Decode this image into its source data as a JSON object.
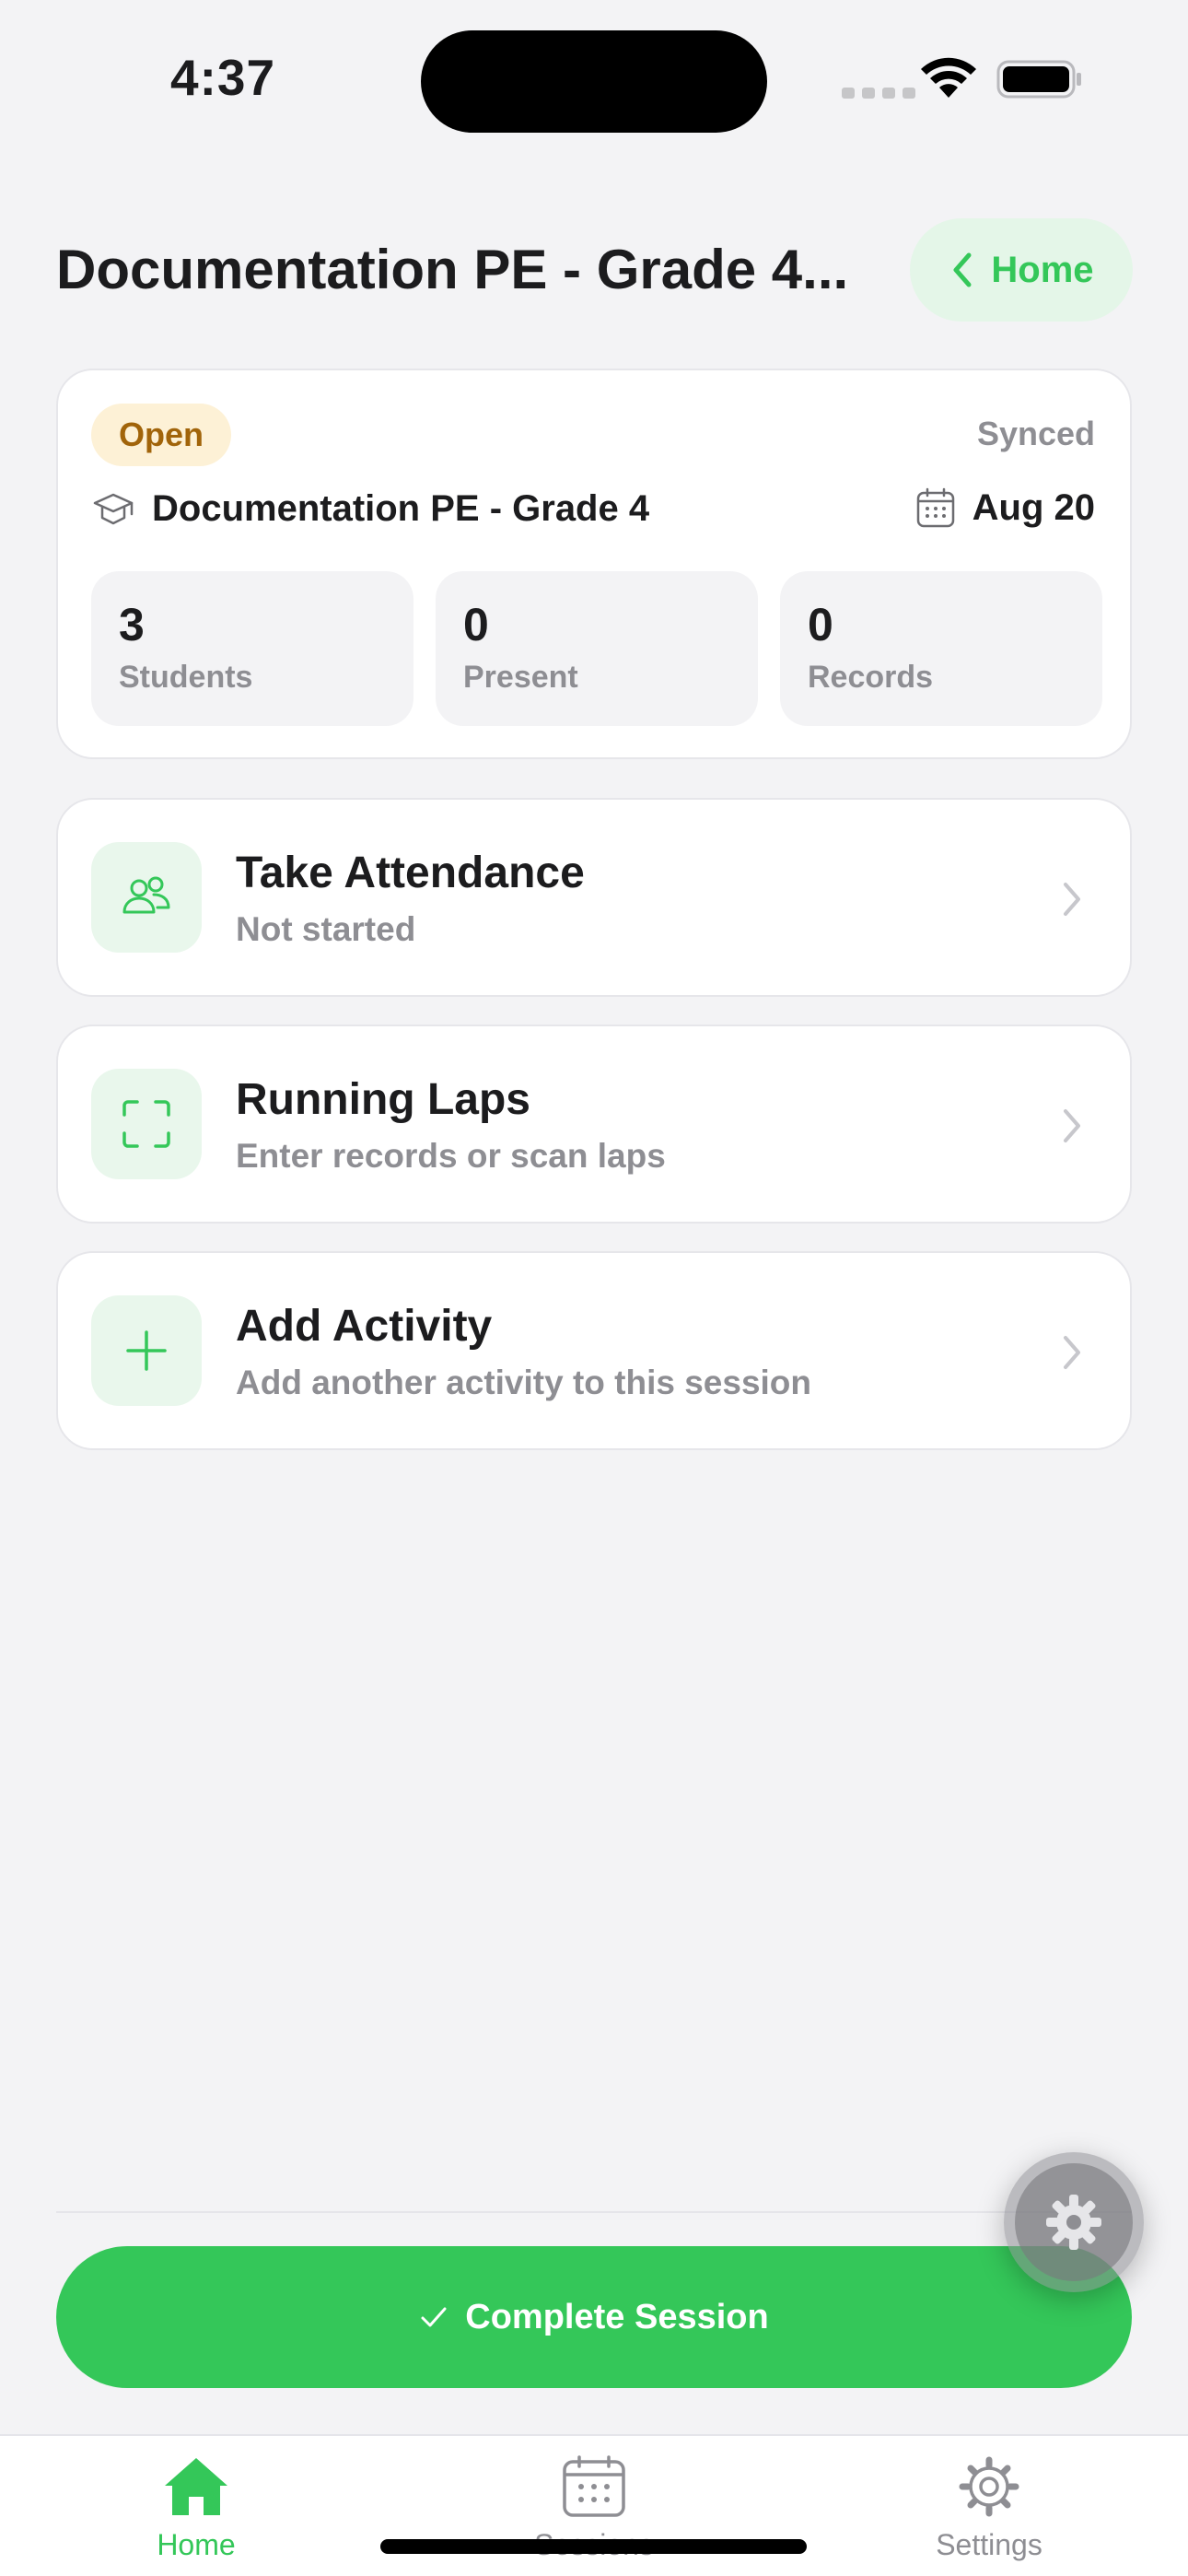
{
  "status_bar": {
    "time": "4:37"
  },
  "header": {
    "title": "Documentation PE - Grade 4...",
    "back_label": "Home"
  },
  "summary": {
    "status_badge": "Open",
    "sync_status": "Synced",
    "class_name": "Documentation PE - Grade 4",
    "date": "Aug 20",
    "stats": [
      {
        "value": "3",
        "label": "Students"
      },
      {
        "value": "0",
        "label": "Present"
      },
      {
        "value": "0",
        "label": "Records"
      }
    ]
  },
  "actions": [
    {
      "title": "Take Attendance",
      "subtitle": "Not started",
      "icon": "people-icon"
    },
    {
      "title": "Running Laps",
      "subtitle": "Enter records or scan laps",
      "icon": "scan-frame-icon"
    },
    {
      "title": "Add Activity",
      "subtitle": "Add another activity to this session",
      "icon": "plus-icon"
    }
  ],
  "complete_button": {
    "label": "Complete Session"
  },
  "tabbar": {
    "items": [
      {
        "label": "Home",
        "icon": "house-icon",
        "active": true
      },
      {
        "label": "Sessions",
        "icon": "calendar-icon",
        "active": false
      },
      {
        "label": "Settings",
        "icon": "gear-icon",
        "active": false
      }
    ]
  },
  "colors": {
    "accent": "#34c759",
    "accent_soft": "#e9f7ec",
    "badge_bg": "#fdf1d6",
    "badge_text": "#a1640a",
    "muted": "#8e8e93",
    "background": "#f3f3f5"
  }
}
